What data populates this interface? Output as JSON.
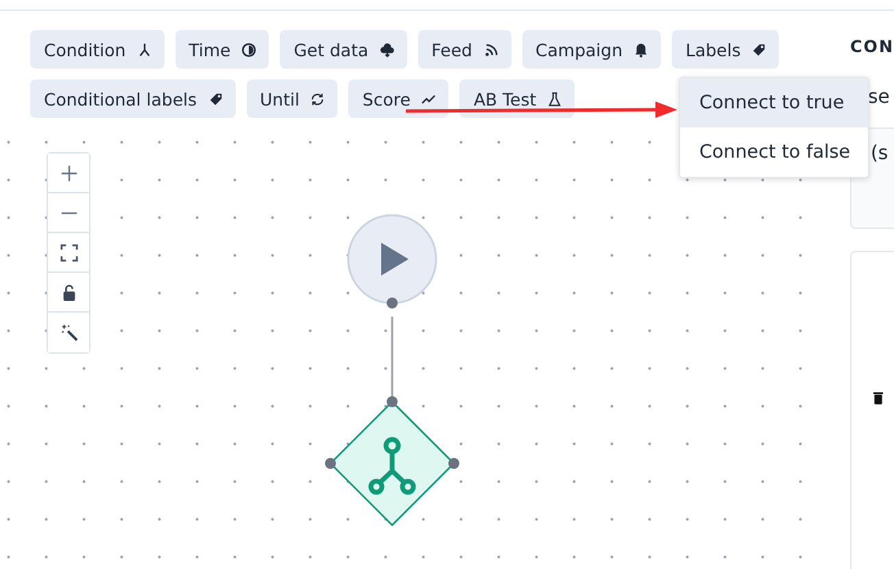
{
  "toolbar": [
    {
      "label": "Condition"
    },
    {
      "label": "Time"
    },
    {
      "label": "Get data"
    },
    {
      "label": "Feed"
    },
    {
      "label": "Campaign"
    },
    {
      "label": "Labels"
    },
    {
      "label": "Conditional labels"
    },
    {
      "label": "Until"
    },
    {
      "label": "Score"
    },
    {
      "label": "AB Test"
    }
  ],
  "menu": [
    {
      "label": "Connect to true",
      "selected": true
    },
    {
      "label": "Connect to false",
      "selected": false
    }
  ],
  "side_panel": {
    "heading": "CON",
    "line": "se",
    "card_text": "(s"
  }
}
